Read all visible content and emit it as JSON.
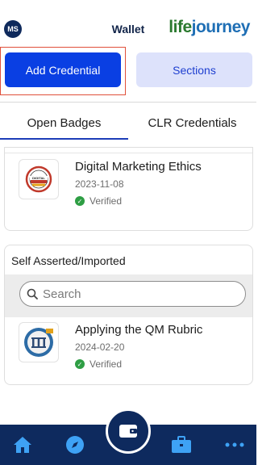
{
  "header": {
    "avatar_initials": "MS",
    "title": "Wallet",
    "logo_life": "life",
    "logo_journey": "journey"
  },
  "actions": {
    "add_credential": "Add Credential",
    "sections": "Sections"
  },
  "tabs": [
    {
      "label": "Open Badges",
      "active": true
    },
    {
      "label": "CLR Credentials",
      "active": false
    }
  ],
  "badges": [
    {
      "title": "Digital Marketing Ethics",
      "date": "2023-11-08",
      "status": "Verified",
      "icon": "digital-marketing-badge"
    }
  ],
  "self_asserted": {
    "title": "Self Asserted/Imported",
    "search_placeholder": "Search",
    "items": [
      {
        "title": "Applying the QM Rubric",
        "date": "2024-02-20",
        "status": "Verified",
        "icon": "qm-rubric-badge"
      }
    ]
  },
  "bottom_nav": {
    "items": [
      "home-icon",
      "compass-icon",
      "wallet-icon",
      "briefcase-icon",
      "more-icon"
    ]
  },
  "colors": {
    "primary": "#0a3fe3",
    "secondary_bg": "#dde2fb",
    "nav_bg": "#0e2a5e",
    "verified": "#2e9e44"
  }
}
